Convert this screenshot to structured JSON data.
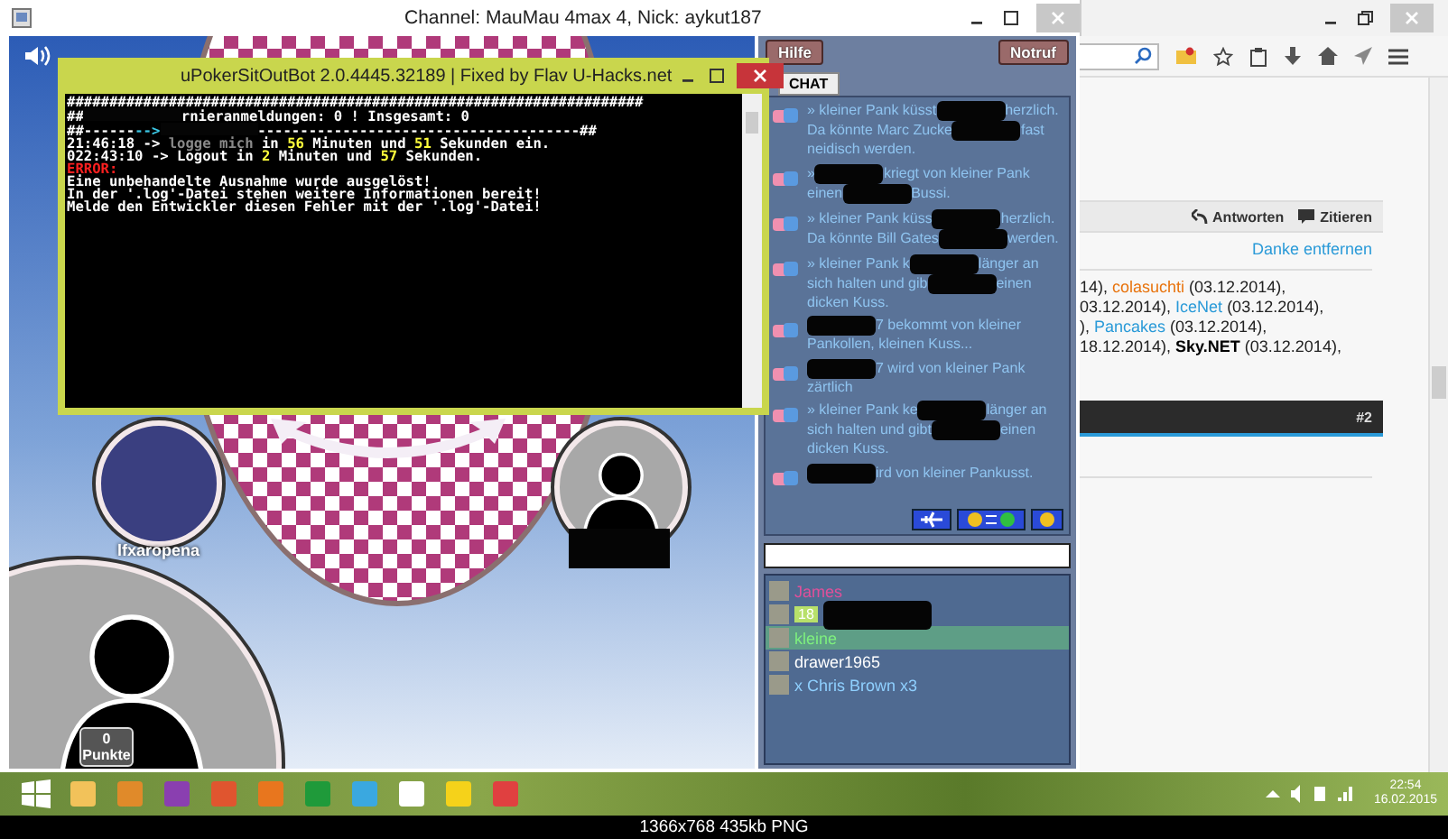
{
  "game_window": {
    "title": "Channel: MauMau 4max 4,  Nick: aykut187"
  },
  "console_window": {
    "title": "uPokerSitOutBot 2.0.4445.32189 | Fixed by Flav U-Hacks.net",
    "lines": [
      {
        "segments": [
          {
            "kind": "text",
            "text": "####################################################################",
            "color": "#ffffff"
          }
        ]
      },
      {
        "segments": [
          {
            "kind": "text",
            "text": "##",
            "color": "#ffffff"
          },
          {
            "kind": "redacted"
          },
          {
            "kind": "text",
            "text": "rnieranmeldungen: 0 ! Insgesamt: 0",
            "color": "#ffffff"
          }
        ]
      },
      {
        "segments": [
          {
            "kind": "text",
            "text": "##------",
            "color": "#ffffff"
          },
          {
            "kind": "text",
            "text": "-->",
            "color": "#3cc8e6"
          },
          {
            "kind": "redacted"
          },
          {
            "kind": "text",
            "text": "--------------------------------------##",
            "color": "#ffffff"
          }
        ]
      },
      {
        "segments": [
          {
            "kind": "text",
            "text": "21:46:18 -> ",
            "color": "#ffffff"
          },
          {
            "kind": "text",
            "text": "logge mich",
            "color": "#8a8a8a"
          },
          {
            "kind": "text",
            "text": " in ",
            "color": "#ffffff"
          },
          {
            "kind": "text",
            "text": "56",
            "color": "#ffff3c"
          },
          {
            "kind": "text",
            "text": " Minuten und ",
            "color": "#ffffff"
          },
          {
            "kind": "text",
            "text": "51",
            "color": "#ffff3c"
          },
          {
            "kind": "text",
            "text": " Sekunden ein.",
            "color": "#ffffff"
          }
        ]
      },
      {
        "segments": [
          {
            "kind": "text",
            "text": "022:43:10 -> Logout in ",
            "color": "#ffffff"
          },
          {
            "kind": "text",
            "text": "2",
            "color": "#ffff3c"
          },
          {
            "kind": "text",
            "text": " Minuten und ",
            "color": "#ffffff"
          },
          {
            "kind": "text",
            "text": "57",
            "color": "#ffff3c"
          },
          {
            "kind": "text",
            "text": " Sekunden.",
            "color": "#ffffff"
          }
        ]
      },
      {
        "segments": [
          {
            "kind": "text",
            "text": "ERROR:",
            "color": "#ff2020"
          }
        ]
      },
      {
        "segments": [
          {
            "kind": "text",
            "text": "Eine unbehandelte Ausnahme wurde ausgelöst!",
            "color": "#ffffff"
          }
        ]
      },
      {
        "segments": [
          {
            "kind": "text",
            "text": "In der '.log'-Datei stehen weitere Informationen bereit!",
            "color": "#ffffff"
          }
        ]
      },
      {
        "segments": [
          {
            "kind": "text",
            "text": "Melde den Entwickler diesen Fehler mit der '.log'-Datei!",
            "color": "#ffffff"
          }
        ]
      }
    ]
  },
  "seats": [
    {
      "name": "lfxaropena"
    },
    {
      "points": "0",
      "points_label": "Punkte"
    }
  ],
  "side_panel": {
    "buttons": [
      "Hilfe",
      "Notruf"
    ],
    "tab": "CHAT",
    "messages": [
      {
        "segments": [
          {
            "kind": "text",
            "text": "» kleiner Pank küsst"
          },
          {
            "kind": "redacted"
          },
          {
            "kind": "text",
            "text": "herzlich. Da könnte Marc Zucke"
          },
          {
            "kind": "redacted"
          },
          {
            "kind": "text",
            "text": "fast neidisch werden."
          }
        ]
      },
      {
        "segments": [
          {
            "kind": "text",
            "text": "»"
          },
          {
            "kind": "redacted"
          },
          {
            "kind": "text",
            "text": "kriegt von kleiner Pank einen"
          },
          {
            "kind": "redacted"
          },
          {
            "kind": "text",
            "text": "Bussi."
          }
        ]
      },
      {
        "segments": [
          {
            "kind": "text",
            "text": "» kleiner Pank küss"
          },
          {
            "kind": "redacted"
          },
          {
            "kind": "text",
            "text": "herzlich. Da könnte Bill Gates"
          },
          {
            "kind": "redacted"
          },
          {
            "kind": "text",
            "text": "werden."
          }
        ]
      },
      {
        "segments": [
          {
            "kind": "text",
            "text": "» kleiner Pank k"
          },
          {
            "kind": "redacted"
          },
          {
            "kind": "text",
            "text": "länger an sich halten und gib"
          },
          {
            "kind": "redacted"
          },
          {
            "kind": "text",
            "text": "einen dicken Kuss."
          }
        ]
      },
      {
        "segments": [
          {
            "kind": "redacted"
          },
          {
            "kind": "text",
            "text": "7 bekommt von kleiner Pank"
          },
          {
            "kind": "text",
            "text": "ollen, kleinen Kuss..."
          }
        ]
      },
      {
        "segments": [
          {
            "kind": "redacted"
          },
          {
            "kind": "text",
            "text": "7 wird von kleiner Pank zärtlich"
          }
        ]
      },
      {
        "segments": [
          {
            "kind": "text",
            "text": "» kleiner Pank ke"
          },
          {
            "kind": "redacted"
          },
          {
            "kind": "text",
            "text": "länger an sich halten und gibt"
          },
          {
            "kind": "redacted"
          },
          {
            "kind": "text",
            "text": "einen dicken Kuss."
          }
        ]
      },
      {
        "segments": [
          {
            "kind": "redacted"
          },
          {
            "kind": "text",
            "text": "ird von kleiner Pank"
          },
          {
            "kind": "text",
            "text": "usst."
          }
        ]
      }
    ],
    "users": [
      {
        "name": "James",
        "color": "#e0509a",
        "selected": false
      },
      {
        "badge": "18",
        "selected": false
      },
      {
        "name": "kleine",
        "color": "#7ef07e",
        "selected": true
      },
      {
        "name": "drawer1965",
        "color": "#ffffff",
        "selected": false
      },
      {
        "name": "x Chris Brown x3",
        "color": "#8fd0ff",
        "selected": false
      }
    ]
  },
  "browser": {
    "actions": [
      "Antworten",
      "Zitieren"
    ],
    "thanks_link": "Danke entfernen",
    "thanks_lines": [
      [
        {
          "text": "14), ",
          "color": "#222222"
        },
        {
          "text": "colasuchti",
          "color": "#e8730c"
        },
        {
          "text": " (03.12.2014),",
          "color": "#222222"
        }
      ],
      [
        {
          "text": "03.12.2014), ",
          "color": "#222222"
        },
        {
          "text": "IceNet",
          "color": "#2a9ad8"
        },
        {
          "text": " (03.12.2014),",
          "color": "#222222"
        }
      ],
      [
        {
          "text": "), ",
          "color": "#222222"
        },
        {
          "text": "Pancakes",
          "color": "#2a9ad8"
        },
        {
          "text": " (03.12.2014),",
          "color": "#222222"
        }
      ],
      [
        {
          "text": "18.12.2014), ",
          "color": "#222222"
        },
        {
          "text": "Sky.NET",
          "color": "#000000",
          "bold": true
        },
        {
          "text": " (03.12.2014),",
          "color": "#222222"
        }
      ]
    ],
    "post_number": "#2"
  },
  "taskbar": {
    "time": "22:54",
    "date": "16.02.2015"
  },
  "caption": "1366x768 435kb PNG"
}
